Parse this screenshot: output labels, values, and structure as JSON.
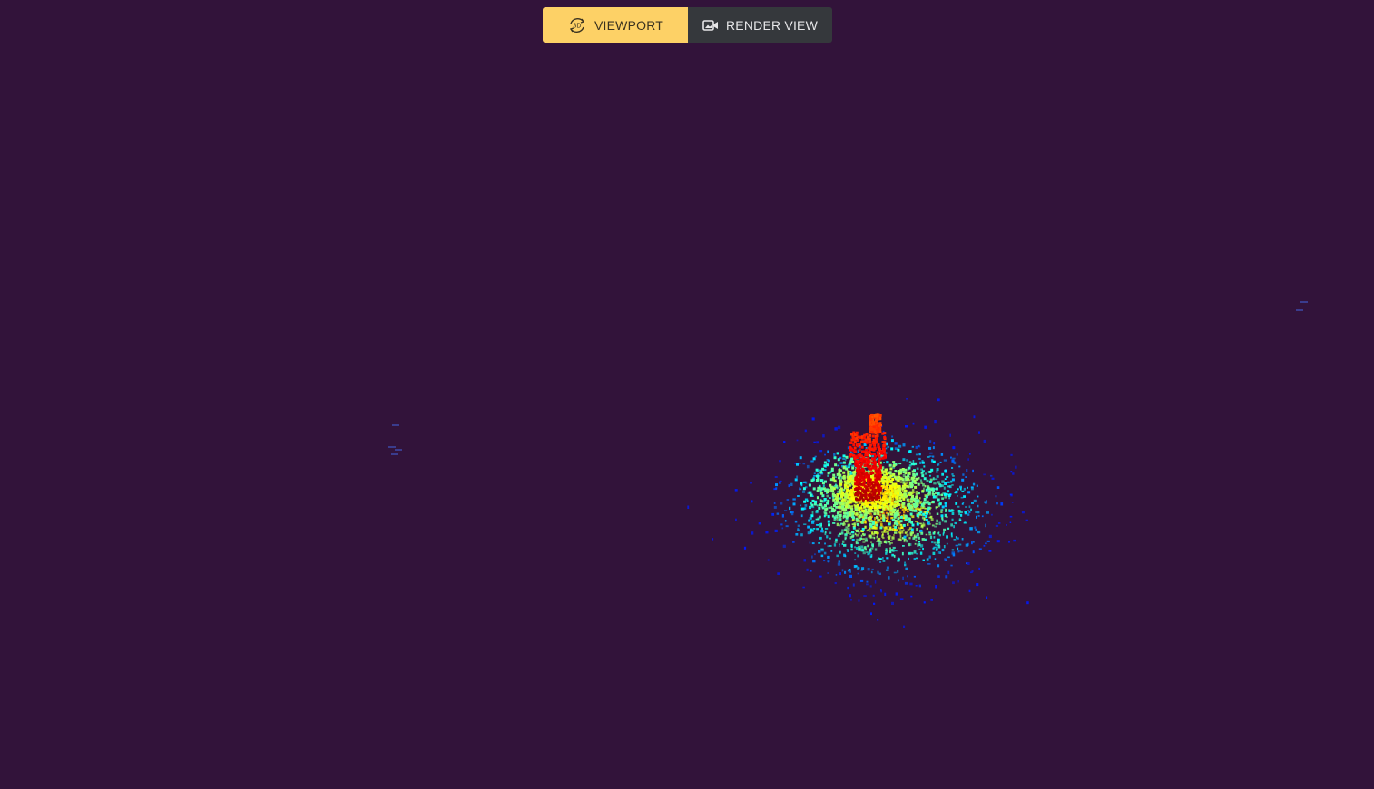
{
  "toolbar": {
    "viewport_label": "VIEWPORT",
    "render_view_label": "RENDER VIEW",
    "active_tab": "viewport",
    "viewport_icon": "3d-rotate-icon",
    "render_view_icon": "video-camera-icon",
    "active_color": "#fdd166",
    "inactive_color": "#35383c",
    "viewport_icon_text": "3D"
  },
  "scene": {
    "background_color": "#32133a",
    "content": "point-cloud",
    "colormap": "jet"
  }
}
